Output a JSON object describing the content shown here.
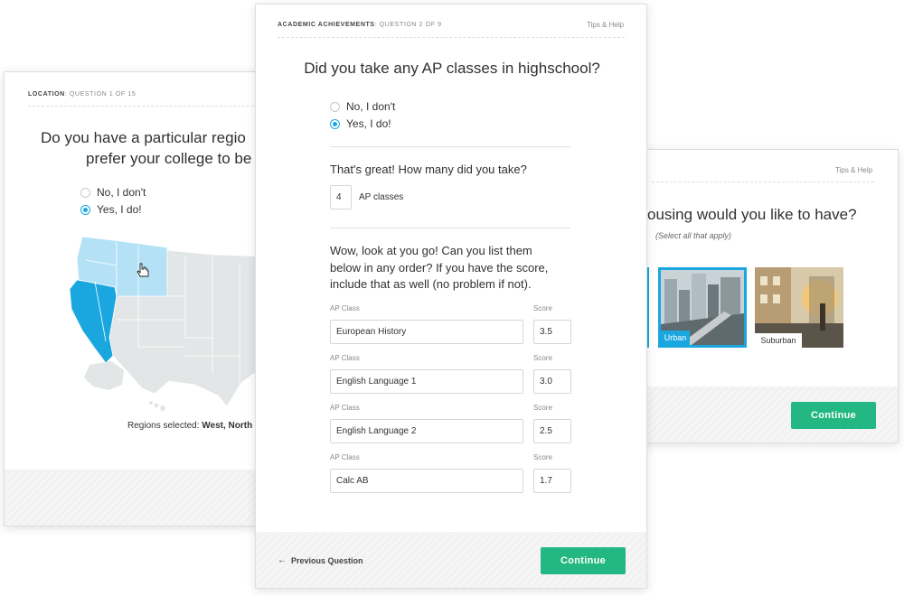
{
  "left_card": {
    "crumb_section": "LOCATION",
    "crumb_rest": ": QUESTION 1 OF 15",
    "question_line1": "Do you have a particular regio",
    "question_line2": "prefer your college to be",
    "options": [
      {
        "label": "No, I don't",
        "checked": false
      },
      {
        "label": "Yes, I do!",
        "checked": true
      }
    ],
    "regions_prefix": "Regions selected: ",
    "regions_value": "West, North",
    "colors": {
      "selected": "#1aa7e0",
      "hover": "#b5e1f6",
      "unselected": "#e3e6e6"
    }
  },
  "right_card": {
    "tips": "Tips & Help",
    "question": "ousing would you like to have?",
    "subtitle": "(Select all that apply)",
    "options": [
      {
        "label": "",
        "selected": true,
        "icon": "city-photo"
      },
      {
        "label": "Urban",
        "selected": true,
        "icon": "urban-photo"
      },
      {
        "label": "Suburban",
        "selected": false,
        "icon": "suburban-photo"
      }
    ],
    "continue_label": "Continue"
  },
  "center_card": {
    "crumb_section": "ACADEMIC ACHIEVEMENTS",
    "crumb_rest": ": QUESTION 2 OF 9",
    "tips": "Tips & Help",
    "question": "Did you take any AP classes in highschool?",
    "options": [
      {
        "label": "No, I don't",
        "checked": false
      },
      {
        "label": "Yes, I do!",
        "checked": true
      }
    ],
    "followup": "That's great! How many did you take?",
    "count_value": "4",
    "count_suffix": "AP classes",
    "list_prompt_1": "Wow, look at you go! Can you list them",
    "list_prompt_2": "below in any order? If you have the score,",
    "list_prompt_3": "include that as well (no problem if not).",
    "col_class": "AP Class",
    "col_score": "Score",
    "rows": [
      {
        "ap_class": "AP Class",
        "score_label": "Score",
        "class": "European History",
        "score": "3.5"
      },
      {
        "ap_class": "AP Class",
        "score_label": "Score",
        "class": "English Language 1",
        "score": "3.0"
      },
      {
        "ap_class": "AP Class",
        "score_label": "Score",
        "class": "English Language 2",
        "score": "2.5"
      },
      {
        "ap_class": "AP Class",
        "score_label": "Score",
        "class": "Calc AB",
        "score": "1.7"
      }
    ],
    "previous_label": "Previous Question",
    "previous_icon": "arrow-left-icon",
    "continue_label": "Continue",
    "accent": "#23b783"
  }
}
